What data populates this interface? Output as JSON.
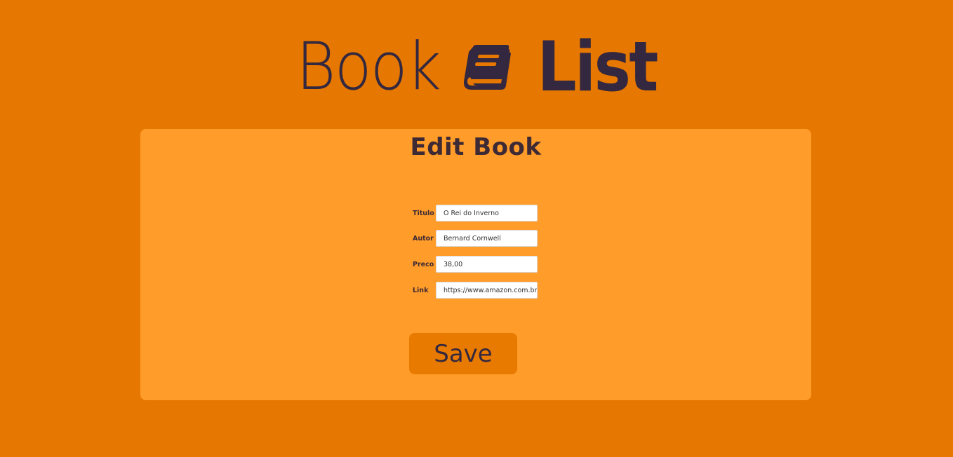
{
  "header": {
    "logo_word_left": "Book",
    "logo_icon": "book-icon",
    "logo_word_right": "List"
  },
  "form": {
    "title": "Edit Book",
    "fields": [
      {
        "label": "Titulo",
        "value": "O Rei do Inverno"
      },
      {
        "label": "Autor",
        "value": "Bernard Cornwell"
      },
      {
        "label": "Preco",
        "value": "38,00"
      },
      {
        "label": "Link",
        "value": "https://www.amazon.com.br"
      }
    ],
    "save_label": "Save"
  },
  "colors": {
    "page_background": "#e67700",
    "card_background": "#ff9c2a",
    "button_background": "#e87a00",
    "text_dark": "#33283f"
  }
}
